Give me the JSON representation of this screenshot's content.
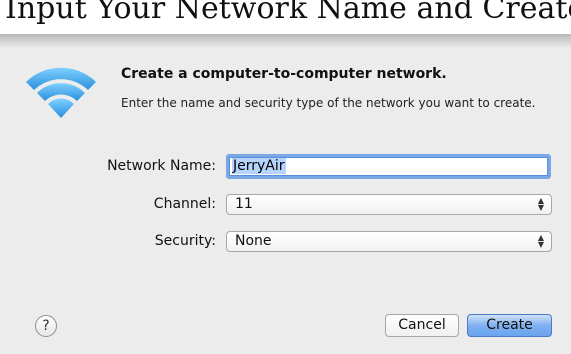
{
  "caption": "Input Your Network Name and Create it",
  "dialog": {
    "headline": "Create a computer-to-computer network.",
    "subtext": "Enter the name and security type of the network you want to create.",
    "network_name_label": "Network Name:",
    "network_name_value": "JerryAir",
    "channel_label": "Channel:",
    "channel_value": "11",
    "security_label": "Security:",
    "security_value": "None",
    "help_glyph": "?",
    "cancel_label": "Cancel",
    "create_label": "Create"
  },
  "colors": {
    "wifi_icon": "#3aa6e8",
    "focus_ring": "#79a8e4",
    "default_button": "#6aa4ee"
  },
  "icons": {
    "wifi": "wifi-icon",
    "popup": "chevron-updown-icon",
    "help": "help-icon"
  }
}
